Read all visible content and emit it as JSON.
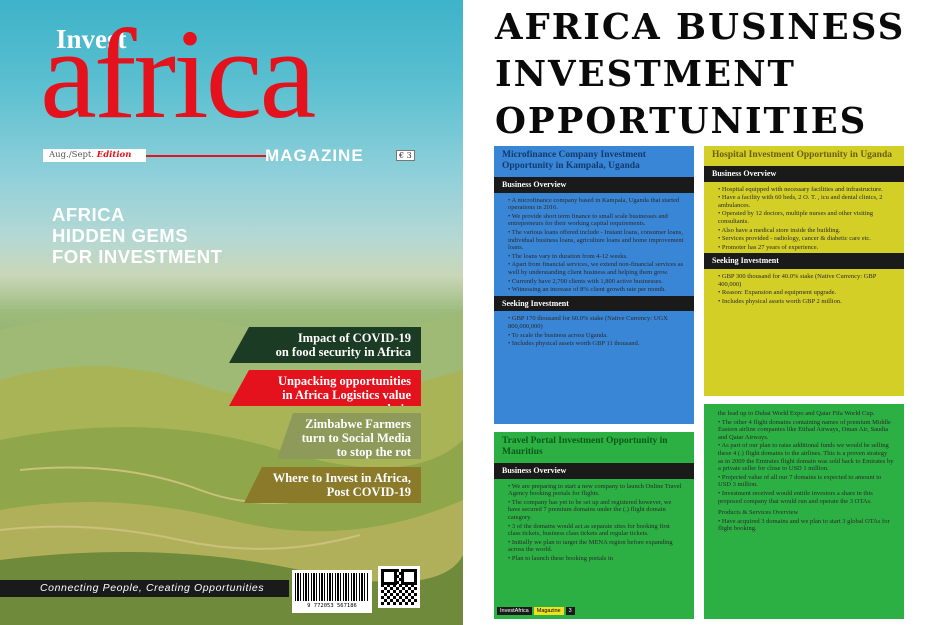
{
  "cover": {
    "invest": "Invest",
    "africa": "africa",
    "edition_prefix": "Aug./Sept.",
    "edition_word": "Edition",
    "magazine": "MAGAZINE",
    "price": "€ 3",
    "headline": [
      "AFRICA",
      "HIDDEN GEMS",
      "FOR INVESTMENT"
    ],
    "tags": [
      {
        "line1": "Impact of COVID-19",
        "line2": "on food security in Africa"
      },
      {
        "line1": "Unpacking opportunities",
        "line2": "in Africa Logistics value chain"
      },
      {
        "line1": "Zimbabwe Farmers",
        "line2": "turn to Social Media",
        "line3": "to stop the rot"
      },
      {
        "line1": "Where to Invest in Africa,",
        "line2": "Post COVID-19"
      }
    ],
    "slogan": "Connecting People, Creating Opportunities",
    "barcode_number": "9 772053 567186"
  },
  "page": {
    "title": [
      "AFRICA BUSINESS",
      "INVESTMENT",
      "OPPORTUNITIES"
    ],
    "blue": {
      "title": "Microfinance Company Investment Opportunity in Kampala, Uganda",
      "section1": "Business Overview",
      "bullets1": [
        "A microfinance company based in Kampala, Uganda that started operations in 2016.",
        "We provide short term finance to small scale businesses and entrepreneurs for their working capital requirements.",
        "The various loans offered include - Instant loans, consumer loans, individual business loans, agriculture loans and home improvement loans.",
        "The loans vary in duration from 4-12 weeks.",
        "Apart from financial services, we extend non-financial services as well by understanding client business and helping them grow.",
        "Currently have 2,700 clients with 1,800 active businesses.",
        "Witnessing an increase of 8% client growth rate per month."
      ],
      "section2": "Seeking Investment",
      "bullets2": [
        "GBP 170 thousand for 60.0% stake (Native Currency: UGX 800,000,000)",
        "To scale the business across Uganda.",
        "Includes physical assets worth GBP 11 thousand."
      ]
    },
    "yellow": {
      "title": "Hospital Investment Opportunity in Uganda",
      "section1": "Business Overview",
      "bullets1": [
        "Hospital equipped with necessary facilities and infrastructure.",
        "Have a facility with 60 beds, 2 O. T. , icu and dental clinics, 2 ambulances.",
        "Operated by 12 doctors, multiple nurses and other visiting consultants.",
        "Also have a medical store inside the building.",
        "Services provided - radiology, cancer & diabetic care etc.",
        "Promoter has 27 years of experience."
      ],
      "section2": "Seeking Investment",
      "bullets2": [
        "GBP 300 thousand for 40.0% stake (Native Currency: GBP 400,000)",
        "Reason: Expansion and equipment upgrade.",
        "Includes physical assets worth GBP 2 million."
      ]
    },
    "green_left": {
      "title": "Travel Portal Investment Opportunity in Mauritius",
      "section1": "Business Overview",
      "bullets1": [
        "We are preparing to start a new company to launch Online Travel Agency booking portals for flights.",
        "The company has yet to be set up and registered however, we have secured 7 premium domains under the (.) flight domain category.",
        "3 of the domains would act as separate sites for booking first class tickets, business class tickets and regular tickets.",
        "Initially we plan to target the MENA region before expanding across the world.",
        "Plan to launch these booking portals in"
      ]
    },
    "green_right": {
      "intro": "the lead up to Dubai World Expo and Qatar Fifa World Cup.",
      "bullets1": [
        "The other 4 flight domains containing names of premium Middle Eastern airline companies like Etihad Airways, Oman Air, Saudia and Qatar Airways.",
        "As part of our plan to raise additional funds we would be selling these 4 (.) flight domains to the airlines. This is a proven strategy as in 2009 the Emirates flight domain was sold back to Emirates by a private seller for close to USD 1 million.",
        "Projected value of all our 7 domains is expected to amount to USD 3 million.",
        "Investment received would entitle investors a share in this proposed company that would run and operate the 3 OTAs."
      ],
      "section": "Products & Services Overview",
      "bullets2": [
        "Have acquired 3 domains and we plan to start 3 global OTAs for flight booking."
      ]
    },
    "footer": [
      "InvestAfrica",
      "Magazine",
      "3"
    ]
  }
}
